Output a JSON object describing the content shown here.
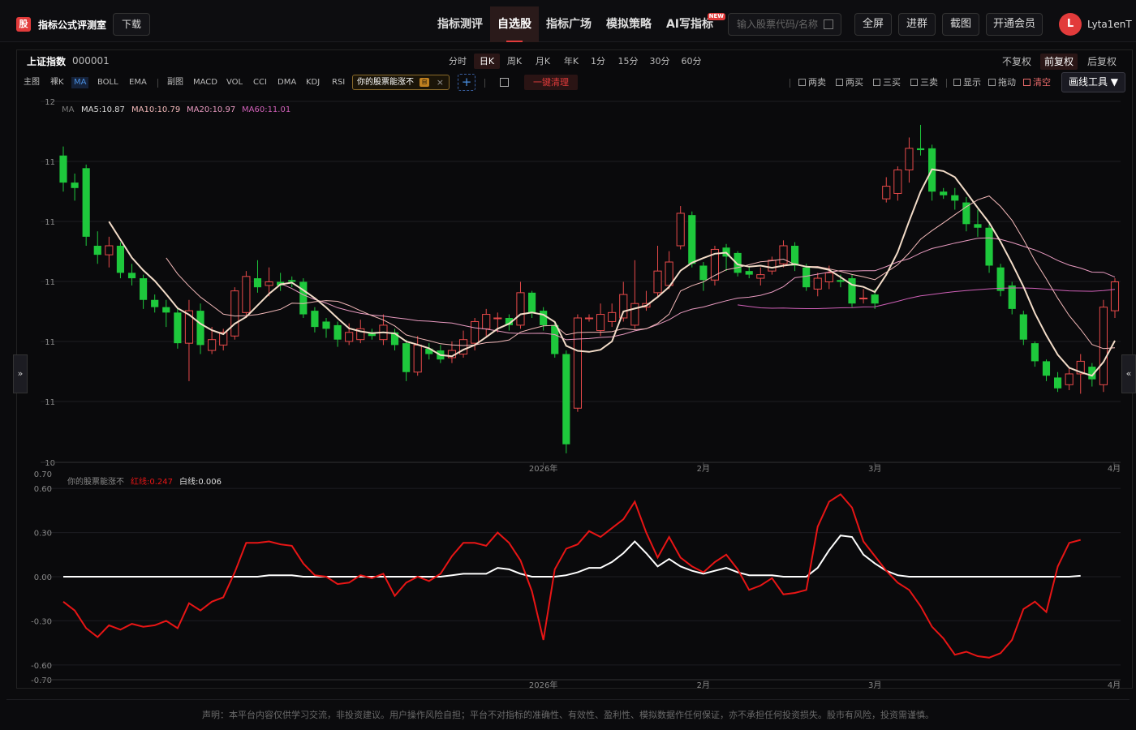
{
  "header": {
    "logo_glyph": "股",
    "app_title": "指标公式评测室",
    "download_label": "下载",
    "nav": [
      {
        "label": "指标测评"
      },
      {
        "label": "自选股",
        "active": true
      },
      {
        "label": "指标广场"
      },
      {
        "label": "模拟策略"
      },
      {
        "label": "AI写指标",
        "badge": "NEW"
      }
    ],
    "search_placeholder": "输入股票代码/名称",
    "buttons": [
      "全屏",
      "进群",
      "截图",
      "开通会员"
    ],
    "avatar_letter": "L",
    "username": "Lyta1enT"
  },
  "instrument": {
    "name": "上证指数",
    "code": "000001"
  },
  "periods": [
    {
      "label": "分时"
    },
    {
      "label": "日K",
      "active": true
    },
    {
      "label": "周K"
    },
    {
      "label": "月K"
    },
    {
      "label": "年K"
    },
    {
      "label": "1分"
    },
    {
      "label": "15分"
    },
    {
      "label": "30分"
    },
    {
      "label": "60分"
    }
  ],
  "adjust": [
    {
      "label": "不复权"
    },
    {
      "label": "前复权",
      "active": true
    },
    {
      "label": "后复权"
    }
  ],
  "toolbar": {
    "main_label": "主图",
    "naked_label": "裸K",
    "ma_label": "MA",
    "boll_label": "BOLL",
    "ema_label": "EMA",
    "sub_label": "副图",
    "macd_label": "MACD",
    "vol_label": "VOL",
    "cci_label": "CCI",
    "dma_label": "DMA",
    "kdj_label": "KDJ",
    "rsi_label": "RSI",
    "indicator_chip": "你的股票能涨不",
    "chip_tag": "自",
    "add_label": "+",
    "clear_label": "一键清理",
    "right_tools": [
      "两卖",
      "两买",
      "三买",
      "三卖",
      "显示",
      "拖动",
      "清空"
    ],
    "draw_label": "画线工具 ▼"
  },
  "side": {
    "left": "»",
    "right": "«"
  },
  "footer": "声明：本平台内容仅供学习交流，非投资建议。用户操作风险自担；平台不对指标的准确性、有效性、盈利性、模拟数据作任何保证，亦不承担任何投资损失。股市有风险，投资需谨慎。",
  "colors": {
    "up": "#e84a4a",
    "down": "#1ec83c",
    "ma5": "#f3dcc8",
    "ma10": "#f2b8b8",
    "ma20": "#e89ac0",
    "ma60": "#d060b8",
    "red_line": "#e81515",
    "white_line": "#ffffff"
  },
  "chart_data": [
    {
      "type": "candlestick",
      "title": "MA",
      "legend": [
        {
          "name": "MA5",
          "value": "10.87"
        },
        {
          "name": "MA10",
          "value": "10.79"
        },
        {
          "name": "MA20",
          "value": "10.97"
        },
        {
          "name": "MA60",
          "value": "11.01"
        }
      ],
      "y_ticks": [
        "12",
        "11",
        "11",
        "11",
        "11",
        "11",
        "10"
      ],
      "x_ticks": [
        "2026年",
        "2月",
        "3月",
        "4月"
      ],
      "ylim": [
        10.0,
        12.0
      ],
      "candles": [
        [
          11.7,
          11.55,
          11.75,
          11.5
        ],
        [
          11.55,
          11.52,
          11.6,
          11.45
        ],
        [
          11.63,
          11.25,
          11.65,
          11.2
        ],
        [
          11.2,
          11.15,
          11.28,
          11.1
        ],
        [
          11.15,
          11.2,
          11.25,
          11.08
        ],
        [
          11.2,
          11.05,
          11.22,
          11.02
        ],
        [
          11.05,
          11.02,
          11.1,
          10.98
        ],
        [
          11.02,
          10.9,
          11.04,
          10.85
        ],
        [
          10.9,
          10.86,
          10.93,
          10.83
        ],
        [
          10.86,
          10.83,
          10.9,
          10.75
        ],
        [
          10.83,
          10.66,
          10.86,
          10.63
        ],
        [
          10.66,
          10.84,
          10.9,
          10.45
        ],
        [
          10.84,
          10.65,
          10.88,
          10.6
        ],
        [
          10.62,
          10.68,
          10.75,
          10.6
        ],
        [
          10.65,
          10.72,
          10.74,
          10.62
        ],
        [
          10.7,
          10.95,
          10.97,
          10.68
        ],
        [
          10.83,
          11.03,
          11.06,
          10.8
        ],
        [
          11.02,
          10.97,
          11.12,
          10.94
        ],
        [
          10.98,
          11.0,
          11.08,
          10.92
        ],
        [
          11.0,
          10.98,
          11.05,
          10.95
        ],
        [
          11.01,
          11.0,
          11.03,
          10.97
        ],
        [
          11.0,
          10.82,
          11.02,
          10.8
        ],
        [
          10.84,
          10.75,
          10.86,
          10.72
        ],
        [
          10.78,
          10.74,
          10.8,
          10.69
        ],
        [
          10.76,
          10.68,
          10.78,
          10.64
        ],
        [
          10.67,
          10.72,
          10.77,
          10.65
        ],
        [
          10.68,
          10.74,
          10.79,
          10.66
        ],
        [
          10.72,
          10.7,
          10.74,
          10.68
        ],
        [
          10.68,
          10.76,
          10.82,
          10.65
        ],
        [
          10.72,
          10.65,
          10.74,
          10.62
        ],
        [
          10.66,
          10.5,
          10.68,
          10.45
        ],
        [
          10.5,
          10.65,
          10.7,
          10.48
        ],
        [
          10.63,
          10.6,
          10.66,
          10.57
        ],
        [
          10.62,
          10.57,
          10.65,
          10.55
        ],
        [
          10.58,
          10.62,
          10.67,
          10.55
        ],
        [
          10.6,
          10.68,
          10.73,
          10.58
        ],
        [
          10.66,
          10.78,
          10.8,
          10.62
        ],
        [
          10.74,
          10.82,
          10.85,
          10.7
        ],
        [
          10.8,
          10.8,
          10.83,
          10.72
        ],
        [
          10.8,
          10.76,
          10.82,
          10.73
        ],
        [
          10.76,
          10.94,
          11.0,
          10.74
        ],
        [
          10.94,
          10.83,
          10.95,
          10.8
        ],
        [
          10.84,
          10.76,
          10.86,
          10.73
        ],
        [
          10.76,
          10.6,
          10.78,
          10.58
        ],
        [
          10.6,
          10.1,
          10.62,
          10.05
        ],
        [
          10.3,
          10.8,
          10.82,
          10.28
        ],
        [
          10.8,
          10.8,
          10.82,
          10.78
        ],
        [
          10.73,
          10.82,
          10.88,
          10.7
        ],
        [
          10.78,
          10.83,
          10.88,
          10.75
        ],
        [
          10.8,
          10.93,
          11.0,
          10.78
        ],
        [
          10.76,
          10.88,
          11.12,
          10.74
        ],
        [
          10.86,
          10.88,
          10.95,
          10.84
        ],
        [
          10.94,
          11.06,
          11.2,
          10.92
        ],
        [
          10.98,
          11.11,
          11.17,
          10.96
        ],
        [
          11.2,
          11.38,
          11.42,
          11.18
        ],
        [
          11.37,
          11.1,
          11.39,
          11.08
        ],
        [
          11.09,
          11.01,
          11.11,
          10.95
        ],
        [
          11.01,
          11.18,
          11.2,
          10.98
        ],
        [
          11.19,
          11.14,
          11.21,
          11.06
        ],
        [
          11.16,
          11.05,
          11.17,
          11.03
        ],
        [
          11.06,
          11.04,
          11.08,
          11.02
        ],
        [
          11.02,
          11.04,
          11.08,
          10.98
        ],
        [
          11.06,
          11.12,
          11.14,
          11.04
        ],
        [
          11.1,
          11.2,
          11.23,
          11.08
        ],
        [
          11.2,
          11.09,
          11.22,
          11.06
        ],
        [
          11.08,
          10.97,
          11.1,
          10.95
        ],
        [
          10.96,
          11.02,
          11.05,
          10.92
        ],
        [
          11.0,
          11.05,
          11.09,
          10.96
        ],
        [
          11.01,
          11.0,
          11.04,
          10.97
        ],
        [
          11.02,
          10.88,
          11.04,
          10.86
        ],
        [
          10.91,
          10.91,
          10.96,
          10.88
        ],
        [
          10.93,
          10.88,
          10.96,
          10.85
        ],
        [
          11.46,
          11.53,
          11.58,
          11.44
        ],
        [
          11.49,
          11.62,
          11.64,
          11.45
        ],
        [
          11.62,
          11.74,
          11.8,
          11.55
        ],
        [
          11.74,
          11.73,
          11.87,
          11.7
        ],
        [
          11.74,
          11.5,
          11.76,
          11.45
        ],
        [
          11.5,
          11.48,
          11.52,
          11.46
        ],
        [
          11.48,
          11.45,
          11.52,
          11.4
        ],
        [
          11.44,
          11.32,
          11.47,
          11.28
        ],
        [
          11.32,
          11.3,
          11.4,
          11.25
        ],
        [
          11.3,
          11.09,
          11.32,
          11.05
        ],
        [
          11.08,
          10.95,
          11.1,
          10.92
        ],
        [
          10.98,
          10.85,
          11.0,
          10.82
        ],
        [
          10.82,
          10.68,
          10.84,
          10.65
        ],
        [
          10.66,
          10.56,
          10.67,
          10.53
        ],
        [
          10.56,
          10.48,
          10.57,
          10.45
        ],
        [
          10.47,
          10.41,
          10.5,
          10.39
        ],
        [
          10.43,
          10.49,
          10.53,
          10.4
        ],
        [
          10.49,
          10.56,
          10.6,
          10.38
        ],
        [
          10.53,
          10.46,
          10.55,
          10.42
        ],
        [
          10.43,
          10.86,
          10.9,
          10.39
        ],
        [
          10.84,
          11.0,
          11.02,
          10.8
        ]
      ]
    },
    {
      "type": "line",
      "title": "你的股票能涨不",
      "legend": [
        {
          "name": "红线",
          "value": "0.247"
        },
        {
          "name": "白线",
          "value": "0.006"
        }
      ],
      "y_ticks": [
        "0.70",
        "0.60",
        "0.30",
        "0.00",
        "-0.30",
        "-0.60",
        "-0.70"
      ],
      "x_ticks": [
        "2026年",
        "2月",
        "3月",
        "4月"
      ],
      "ylim": [
        -0.7,
        0.7
      ],
      "series": [
        {
          "name": "红线",
          "values": [
            -0.17,
            -0.23,
            -0.35,
            -0.41,
            -0.33,
            -0.36,
            -0.32,
            -0.34,
            -0.33,
            -0.3,
            -0.35,
            -0.18,
            -0.23,
            -0.17,
            -0.14,
            0.03,
            0.23,
            0.23,
            0.24,
            0.22,
            0.21,
            0.09,
            0.01,
            0.0,
            -0.05,
            -0.04,
            0.01,
            -0.01,
            0.02,
            -0.13,
            -0.04,
            0.0,
            -0.03,
            0.02,
            0.14,
            0.23,
            0.23,
            0.21,
            0.3,
            0.23,
            0.11,
            -0.1,
            -0.43,
            0.05,
            0.19,
            0.22,
            0.31,
            0.27,
            0.33,
            0.39,
            0.51,
            0.3,
            0.13,
            0.27,
            0.13,
            0.07,
            0.03,
            0.1,
            0.15,
            0.05,
            -0.09,
            -0.06,
            -0.01,
            -0.12,
            -0.11,
            -0.09,
            0.34,
            0.51,
            0.56,
            0.47,
            0.24,
            0.14,
            0.04,
            -0.04,
            -0.09,
            -0.2,
            -0.34,
            -0.42,
            -0.53,
            -0.51,
            -0.54,
            -0.55,
            -0.52,
            -0.43,
            -0.22,
            -0.17,
            -0.24,
            0.07,
            0.23,
            0.25
          ]
        },
        {
          "name": "白线",
          "values": [
            0,
            0,
            0,
            0,
            0,
            0,
            0,
            0,
            0,
            0,
            0,
            0,
            0,
            0,
            0,
            0,
            0,
            0,
            0.01,
            0.01,
            0.01,
            0,
            0,
            0,
            0,
            0,
            0,
            0,
            0,
            0,
            0,
            0,
            0,
            0,
            0.01,
            0.02,
            0.02,
            0.02,
            0.06,
            0.05,
            0.02,
            0,
            0,
            0,
            0.01,
            0.03,
            0.06,
            0.06,
            0.1,
            0.16,
            0.24,
            0.16,
            0.07,
            0.12,
            0.07,
            0.04,
            0.02,
            0.04,
            0.06,
            0.03,
            0.01,
            0.01,
            0.01,
            0,
            0,
            0,
            0.06,
            0.18,
            0.28,
            0.27,
            0.15,
            0.09,
            0.04,
            0.01,
            0,
            0,
            0,
            0,
            0,
            0,
            0,
            0,
            0,
            0,
            0,
            0,
            0,
            0,
            0,
            0.006
          ]
        }
      ]
    }
  ]
}
